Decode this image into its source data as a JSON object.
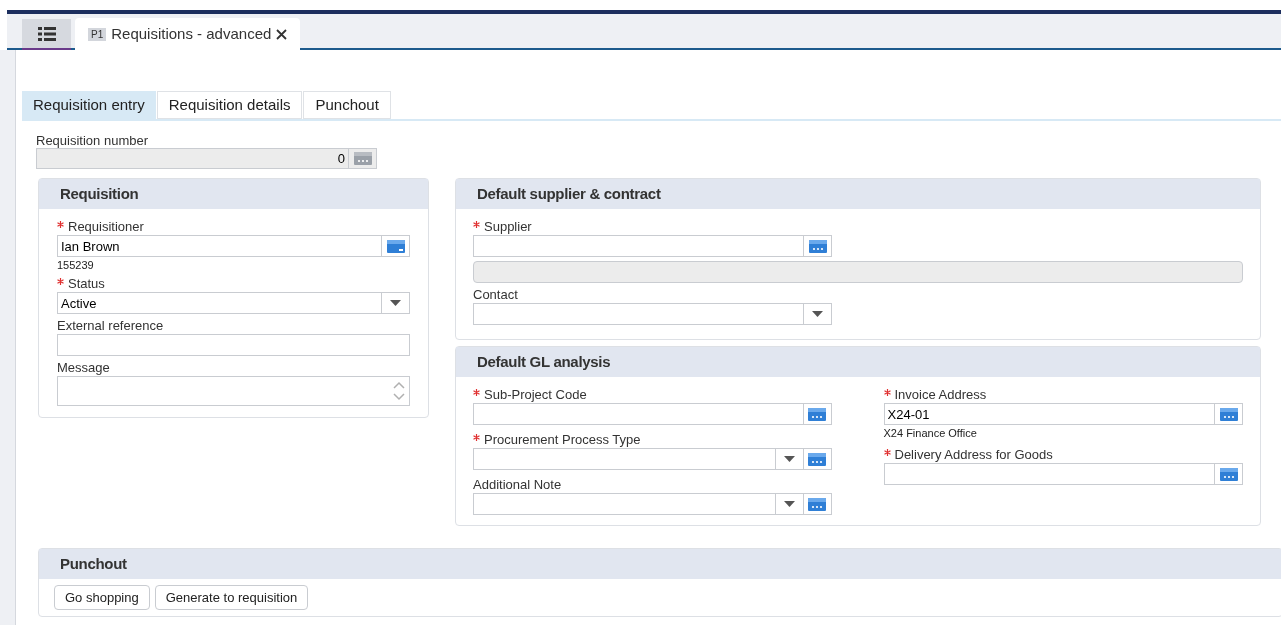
{
  "document_tab": {
    "badge": "P1",
    "title": "Requisitions - advanced",
    "closable": true
  },
  "form_tabs": [
    {
      "label": "Requisition entry",
      "selected": true
    },
    {
      "label": "Requisition details",
      "selected": false
    },
    {
      "label": "Punchout",
      "selected": false
    }
  ],
  "requisition_number": {
    "label": "Requisition number",
    "value": "0"
  },
  "requisition": {
    "title": "Requisition",
    "fields": [
      {
        "label": "Requisitioner",
        "required": true,
        "kind": "person",
        "value": "Ian Brown",
        "note": "155239"
      },
      {
        "label": "Status",
        "required": true,
        "kind": "select",
        "value": "Active"
      },
      {
        "label": "External reference",
        "required": false,
        "kind": "text"
      },
      {
        "label": "Message",
        "required": false,
        "kind": "textarea"
      }
    ]
  },
  "supplier_contract": {
    "title": "Default supplier & contract",
    "fields": [
      {
        "label": "Supplier",
        "required": true,
        "kind": "lookup"
      },
      {
        "kind": "readonly"
      },
      {
        "label": "Contact",
        "required": false,
        "kind": "select"
      }
    ]
  },
  "gl_analysis": {
    "title": "Default GL analysis",
    "left_fields": [
      {
        "label": "Sub-Project Code",
        "required": true,
        "kind": "lookup"
      },
      {
        "label": "Procurement Process Type",
        "required": true,
        "kind": "select-lookup"
      },
      {
        "label": "Additional Note",
        "required": false,
        "kind": "select-lookup"
      }
    ],
    "right_fields": [
      {
        "label": "Invoice Address",
        "required": true,
        "kind": "lookup",
        "value": "X24-01",
        "note": "X24 Finance Office"
      },
      {
        "label": "Delivery Address for Goods",
        "required": true,
        "kind": "lookup"
      }
    ]
  },
  "punchout": {
    "title": "Punchout",
    "buttons": [
      "Go shopping",
      "Generate to requisition"
    ]
  }
}
